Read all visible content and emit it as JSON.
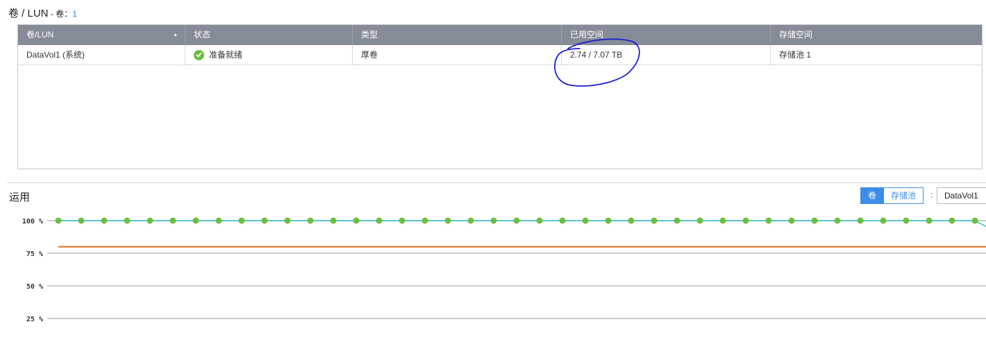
{
  "header": {
    "title": "卷 / LUN",
    "sep": " - ",
    "count_label": "卷：",
    "count_value": "1"
  },
  "table": {
    "columns": [
      "卷/LUN",
      "状态",
      "类型",
      "已用空间",
      "存储空间"
    ],
    "rows": [
      {
        "name": "DataVol1 (系统)",
        "status": "准备就绪",
        "type": "厚卷",
        "used": "2.74 / 7.07 TB",
        "pool": "存储池 1"
      }
    ]
  },
  "usage": {
    "title": "运用",
    "toggle": {
      "volume": "卷",
      "pool": "存储池"
    },
    "colon": ":",
    "selected_volume": "DataVol1"
  },
  "colors": {
    "header_bg": "#868b98",
    "status_ok": "#6cbf3d",
    "accent": "#3d8de8",
    "annotation": "#1a1ad6",
    "series_usage": "#5bc4d8",
    "series_points": "#6cbf3d",
    "series_threshold": "#e06b1e"
  },
  "chart_data": {
    "type": "line",
    "y_ticks": [
      "100 %",
      "75 %",
      "50 %",
      "25 %"
    ],
    "ylim": [
      25,
      100
    ],
    "series": [
      {
        "values": [
          100,
          100,
          100,
          100,
          100,
          100,
          100,
          100,
          100,
          100,
          100,
          100,
          100,
          100,
          100,
          100,
          100,
          100,
          100,
          100,
          100,
          100,
          100,
          100,
          100,
          100,
          100,
          100,
          100,
          100,
          100,
          100,
          100,
          100,
          100,
          100,
          100,
          100,
          100,
          100,
          100,
          91
        ]
      },
      {
        "values": [
          80,
          80
        ]
      }
    ]
  }
}
